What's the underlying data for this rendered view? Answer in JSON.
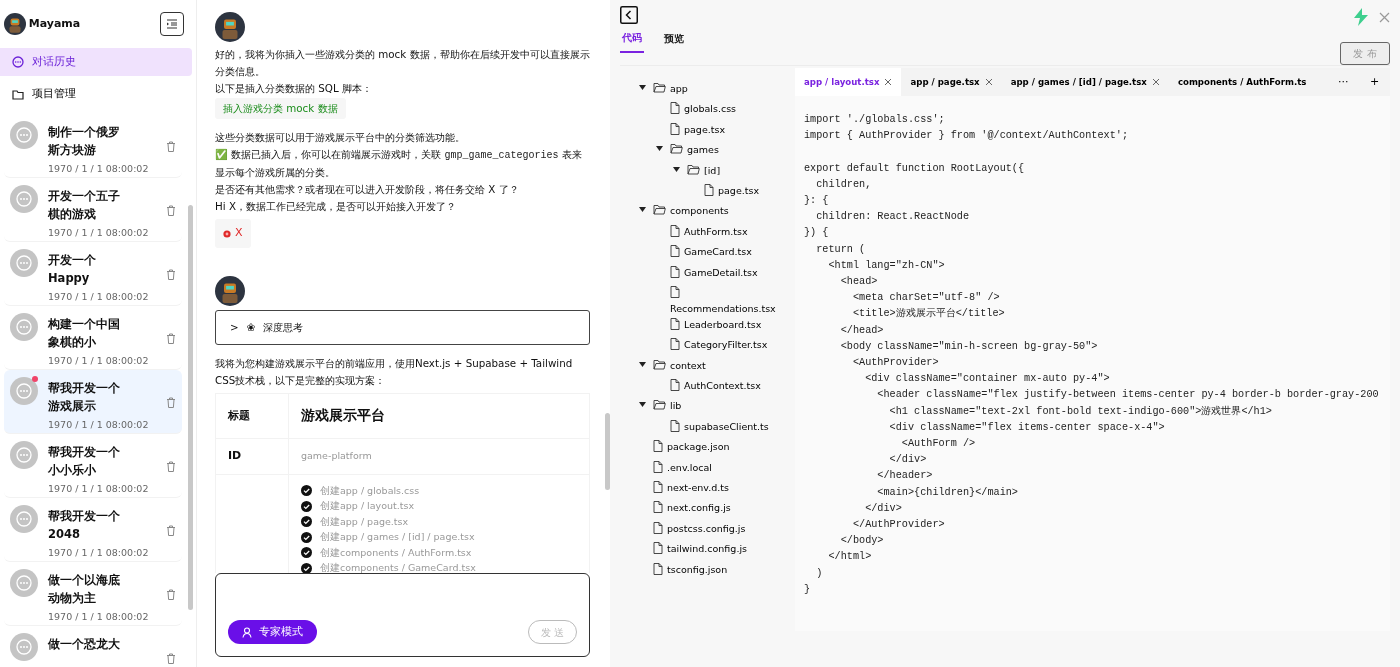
{
  "sidebar": {
    "user": {
      "name": "Mayama"
    },
    "nav": [
      {
        "label": "对话历史",
        "selected": true
      },
      {
        "label": "项目管理",
        "selected": false
      }
    ],
    "conversations": [
      {
        "title": "制作一个俄罗斯方块游",
        "date": "1970 / 1 / 1 08:00:02",
        "selected": false,
        "unread": false
      },
      {
        "title": "开发一个五子棋的游戏",
        "date": "1970 / 1 / 1 08:00:02",
        "selected": false,
        "unread": false
      },
      {
        "title": "开发一个 Happy",
        "date": "1970 / 1 / 1 08:00:02",
        "selected": false,
        "unread": false
      },
      {
        "title": "构建一个中国象棋的小",
        "date": "1970 / 1 / 1 08:00:02",
        "selected": false,
        "unread": false
      },
      {
        "title": "帮我开发一个游戏展示",
        "date": "1970 / 1 / 1 08:00:02",
        "selected": true,
        "unread": true
      },
      {
        "title": "帮我开发一个小小乐小",
        "date": "1970 / 1 / 1 08:00:02",
        "selected": false,
        "unread": false
      },
      {
        "title": "帮我开发一个2048",
        "date": "1970 / 1 / 1 08:00:02",
        "selected": false,
        "unread": false
      },
      {
        "title": "做一个以海底动物为主",
        "date": "1970 / 1 / 1 08:00:02",
        "selected": false,
        "unread": false
      },
      {
        "title": "做一个恐龙大",
        "selected": false,
        "unread": false
      }
    ]
  },
  "chat": {
    "messages": [
      {
        "blocks": [
          {
            "kind": "paragraph",
            "parts": [
              {
                "text": "好的，我将为你插入一些游戏分类的 mock 数据，帮助你在后续开发中可以直接展示分类信息。"
              }
            ]
          },
          {
            "kind": "paragraph",
            "parts": [
              {
                "text": "以下是插入分类数据的 SQL 脚本："
              }
            ]
          },
          {
            "kind": "chip",
            "text": "插入游戏分类 mock 数据"
          },
          {
            "kind": "paragraph",
            "parts": [
              {
                "text": "这些分类数据可以用于游戏展示平台中的分类筛选功能。"
              }
            ]
          },
          {
            "kind": "paragraph",
            "parts": [
              {
                "text": "✅ 数据已插入后，你可以在前端展示游戏时，关联 "
              },
              {
                "text": "gmp_game_categories",
                "code": true
              },
              {
                "text": " 表来显示每个游戏所属的分类。"
              }
            ]
          },
          {
            "kind": "paragraph",
            "parts": [
              {
                "text": "是否还有其他需求？或者现在可以进入开发阶段，将任务交给 X 了？"
              }
            ]
          },
          {
            "kind": "paragraph",
            "parts": [
              {
                "text": "Hi X，数据工作已经完成，是否可以开始接入开发了？"
              }
            ]
          },
          {
            "kind": "error_chip",
            "text": "X"
          }
        ]
      },
      {
        "blocks": [
          {
            "kind": "thinking",
            "caret": ">",
            "glyph": "❀",
            "label": "深度思考",
            "expanded": false
          },
          {
            "kind": "paragraph",
            "parts": [
              {
                "text": "我将为您构建游戏展示平台的前端应用，使用Next.js + Supabase + Tailwind CSS技术栈，以下是完整的实现方案："
              }
            ]
          },
          {
            "kind": "table",
            "rows": [
              {
                "kind": "title",
                "label": "标题",
                "value": "游戏展示平台"
              },
              {
                "kind": "muted",
                "label": "ID",
                "value": "game-platform"
              },
              {
                "kind": "tasks",
                "tasks": [
                  {
                    "text": "创建app / globals.css",
                    "done": true
                  },
                  {
                    "text": "创建app / layout.tsx",
                    "done": true
                  },
                  {
                    "text": "创建app / page.tsx",
                    "done": true
                  },
                  {
                    "text": "创建app / games / [id] / page.tsx",
                    "done": true
                  },
                  {
                    "text": "创建components / AuthForm.tsx",
                    "done": true
                  },
                  {
                    "text": "创建components / GameCard.tsx",
                    "done": true
                  }
                ]
              }
            ]
          }
        ]
      }
    ],
    "input": {
      "mode_button": "专家模式",
      "send_button": "发 送",
      "send_disabled": true
    }
  },
  "workspace": {
    "tabs": [
      {
        "label": "代码",
        "selected": true
      },
      {
        "label": "预览",
        "selected": false
      }
    ],
    "publish_button": {
      "label": "发 布",
      "disabled": true
    },
    "tree": [
      {
        "kind": "folder",
        "name": "app",
        "expanded": true,
        "children": [
          {
            "kind": "file",
            "name": "globals.css"
          },
          {
            "kind": "file",
            "name": "page.tsx"
          },
          {
            "kind": "folder",
            "name": "games",
            "expanded": true,
            "children": [
              {
                "kind": "folder",
                "name": "[id]",
                "expanded": true,
                "children": [
                  {
                    "kind": "file",
                    "name": "page.tsx"
                  }
                ]
              }
            ]
          }
        ]
      },
      {
        "kind": "folder",
        "name": "components",
        "expanded": true,
        "children": [
          {
            "kind": "file",
            "name": "AuthForm.tsx"
          },
          {
            "kind": "file",
            "name": "GameCard.tsx"
          },
          {
            "kind": "file",
            "name": "GameDetail.tsx"
          },
          {
            "kind": "file",
            "name": "Recommendations.tsx"
          },
          {
            "kind": "file",
            "name": "Leaderboard.tsx"
          },
          {
            "kind": "file",
            "name": "CategoryFilter.tsx"
          }
        ]
      },
      {
        "kind": "folder",
        "name": "context",
        "expanded": true,
        "children": [
          {
            "kind": "file",
            "name": "AuthContext.tsx"
          }
        ]
      },
      {
        "kind": "folder",
        "name": "lib",
        "expanded": true,
        "children": [
          {
            "kind": "file",
            "name": "supabaseClient.ts"
          }
        ]
      },
      {
        "kind": "file",
        "name": "package.json"
      },
      {
        "kind": "file",
        "name": ".env.local"
      },
      {
        "kind": "file",
        "name": "next-env.d.ts"
      },
      {
        "kind": "file",
        "name": "next.config.js"
      },
      {
        "kind": "file",
        "name": "postcss.config.js"
      },
      {
        "kind": "file",
        "name": "tailwind.config.js"
      },
      {
        "kind": "file",
        "name": "tsconfig.json"
      }
    ],
    "editor_tabs": [
      {
        "label": "app / layout.tsx",
        "selected": true,
        "closable": true
      },
      {
        "label": "app / page.tsx",
        "selected": false,
        "closable": true
      },
      {
        "label": "app / games / [id] / page.tsx",
        "selected": false,
        "closable": true
      },
      {
        "label": "components / AuthForm.ts",
        "selected": false,
        "closable": false
      }
    ],
    "more_tabs": "···",
    "add_tab": "+",
    "code_blocks": [
      [
        "import './globals.css';",
        "import { AuthProvider } from '@/context/AuthContext';"
      ],
      [
        "export default function RootLayout({",
        "  children,",
        "}: {",
        "  children: React.ReactNode",
        "}) {",
        "  return (",
        "    <html lang=\"zh-CN\">",
        "      <head>",
        "        <meta charSet=\"utf-8\" />",
        "        <title>游戏展示平台</title>",
        "      </head>",
        "      <body className=\"min-h-screen bg-gray-50\">",
        "        <AuthProvider>",
        "          <div className=\"container mx-auto py-4\">",
        "            <header className=\"flex justify-between items-center py-4 border-b border-gray-200",
        "              <h1 className=\"text-2xl font-bold text-indigo-600\">游戏世界</h1>",
        "              <div className=\"flex items-center space-x-4\">",
        "                <AuthForm />",
        "              </div>",
        "            </header>",
        "            <main>{children}</main>",
        "          </div>",
        "        </AuthProvider>",
        "      </body>",
        "    </html>",
        "  )",
        "}"
      ]
    ]
  }
}
